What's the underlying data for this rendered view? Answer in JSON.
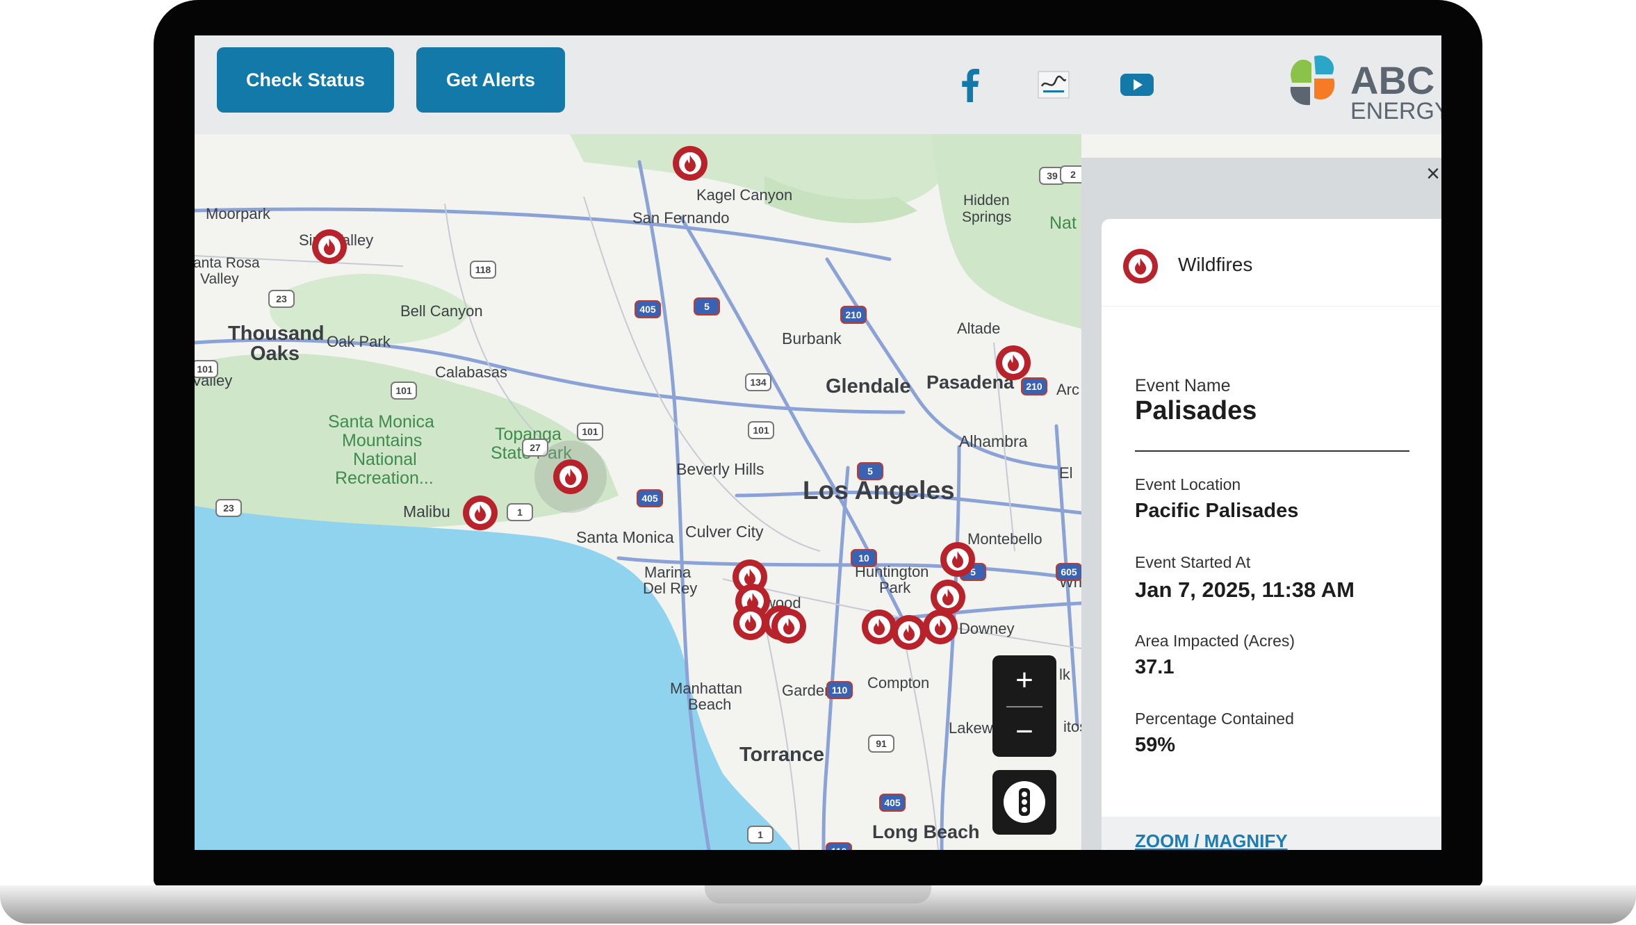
{
  "header": {
    "check_status_label": "Check Status",
    "get_alerts_label": "Get Alerts"
  },
  "social": {
    "facebook_icon": "facebook-icon",
    "partner_badge_icon": "partner-badge-icon",
    "youtube_icon": "youtube-icon"
  },
  "brand": {
    "name_line1": "ABC",
    "name_line2": "ENERGY",
    "colors": {
      "blue": "#1279a8",
      "green": "#8bc34a",
      "orange": "#f57c24",
      "teal": "#2aa6c9",
      "gray": "#5b6670"
    }
  },
  "map": {
    "labels": [
      "Moorpark",
      "Simi Valley",
      "anta Rosa",
      "Valley",
      "Thousand",
      "Oaks",
      "Oak Park",
      "Bell Canyon",
      "Calabasas",
      "Valley",
      "Santa Monica",
      "Mountains",
      "National",
      "Recreation...",
      "Topanga",
      "State Park",
      "Malibu",
      "Santa Monica",
      "Marina",
      "Del Rey",
      "Culver City",
      "Beverly Hills",
      "Los Angeles",
      "Kagel Canyon",
      "San Fernando",
      "Hidden",
      "Springs",
      "Nat",
      "Burbank",
      "Glendale",
      "Pasadena",
      "Altade",
      "Arc",
      "Alhambra",
      "El",
      "Montebello",
      "Wh",
      "Huntington",
      "Park",
      "Downey",
      "wood",
      "Manhattan",
      "Beach",
      "Gardena",
      "Compton",
      "Lakew",
      "Torrance",
      "Long Beach",
      "lk",
      "itos"
    ],
    "route_shields": [
      "118",
      "23",
      "101",
      "101",
      "101",
      "27",
      "23",
      "1",
      "405",
      "5",
      "210",
      "134",
      "101",
      "5",
      "210",
      "405",
      "10",
      "5",
      "605",
      "110",
      "91",
      "405",
      "1",
      "110",
      "39",
      "2"
    ]
  },
  "controls": {
    "zoom_in_label": "+",
    "zoom_out_label": "−",
    "close_label": "×"
  },
  "event_panel": {
    "type_label": "Wildfires",
    "fields": [
      {
        "label": "Event Name",
        "value": "Palisades"
      },
      {
        "label": "Event Location",
        "value": "Pacific Palisades"
      },
      {
        "label": "Event Started At",
        "value": "Jan 7, 2025, 11:38 AM"
      },
      {
        "label": "Area Impacted (Acres)",
        "value": "37.1"
      },
      {
        "label": "Percentage Contained",
        "value": "59%"
      }
    ],
    "zoom_link_label": "ZOOM / MAGNIFY"
  },
  "theme": {
    "fire_marker": "#b8232b",
    "water": "#8fd3ee",
    "land": "#f3f3f0",
    "park": "#cfe6c8"
  }
}
